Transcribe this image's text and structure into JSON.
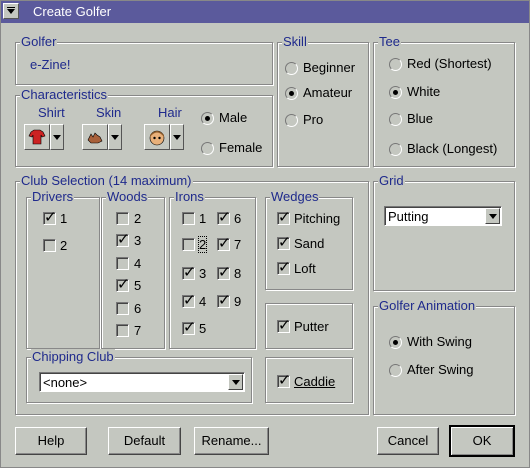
{
  "window": {
    "title": "Create Golfer"
  },
  "golfer": {
    "label": "Golfer",
    "name": "e-Zine!"
  },
  "skill": {
    "label": "Skill",
    "options": [
      "Beginner",
      "Amateur",
      "Pro"
    ],
    "selected": "Amateur"
  },
  "tee": {
    "label": "Tee",
    "options": [
      "Red (Shortest)",
      "White",
      "Blue",
      "Black (Longest)"
    ],
    "selected": "White"
  },
  "characteristics": {
    "label": "Characteristics",
    "shirt": "Shirt",
    "skin": "Skin",
    "hair": "Hair",
    "gender_options": [
      "Male",
      "Female"
    ],
    "gender_selected": "Male",
    "icons": {
      "shirt": "shirt-icon",
      "skin": "hand-icon",
      "hair": "face-icon"
    }
  },
  "club_selection": {
    "label": "Club Selection  (14 maximum)",
    "drivers": {
      "label": "Drivers",
      "items": [
        {
          "n": "1",
          "on": true
        },
        {
          "n": "2",
          "on": false
        }
      ]
    },
    "woods": {
      "label": "Woods",
      "items": [
        {
          "n": "2",
          "on": false
        },
        {
          "n": "3",
          "on": true
        },
        {
          "n": "4",
          "on": false
        },
        {
          "n": "5",
          "on": true
        },
        {
          "n": "6",
          "on": false
        },
        {
          "n": "7",
          "on": false
        }
      ]
    },
    "irons": {
      "label": "Irons",
      "items": [
        {
          "n": "1",
          "on": false
        },
        {
          "n": "2",
          "on": false
        },
        {
          "n": "3",
          "on": true
        },
        {
          "n": "4",
          "on": true
        },
        {
          "n": "5",
          "on": true
        },
        {
          "n": "6",
          "on": true
        },
        {
          "n": "7",
          "on": true
        },
        {
          "n": "8",
          "on": true
        },
        {
          "n": "9",
          "on": true
        }
      ]
    },
    "wedges": {
      "label": "Wedges",
      "items": [
        {
          "n": "Pitching",
          "on": true
        },
        {
          "n": "Sand",
          "on": true
        },
        {
          "n": "Loft",
          "on": true
        }
      ]
    },
    "putter": {
      "label": "Putter",
      "on": true
    },
    "chipping": {
      "label": "Chipping Club",
      "value": "<none>"
    },
    "caddie": {
      "label": "Caddie",
      "on": true
    }
  },
  "grid": {
    "label": "Grid",
    "value": "Putting"
  },
  "animation": {
    "label": "Golfer Animation",
    "options": [
      "With Swing",
      "After Swing"
    ],
    "selected": "With Swing"
  },
  "buttons": {
    "help": "Help",
    "default": "Default",
    "rename": "Rename...",
    "cancel": "Cancel",
    "ok": "OK"
  },
  "colors": {
    "title_bar": "#5b5a9c",
    "group_label": "#1f2a8c",
    "shirt": "#cc2222"
  }
}
